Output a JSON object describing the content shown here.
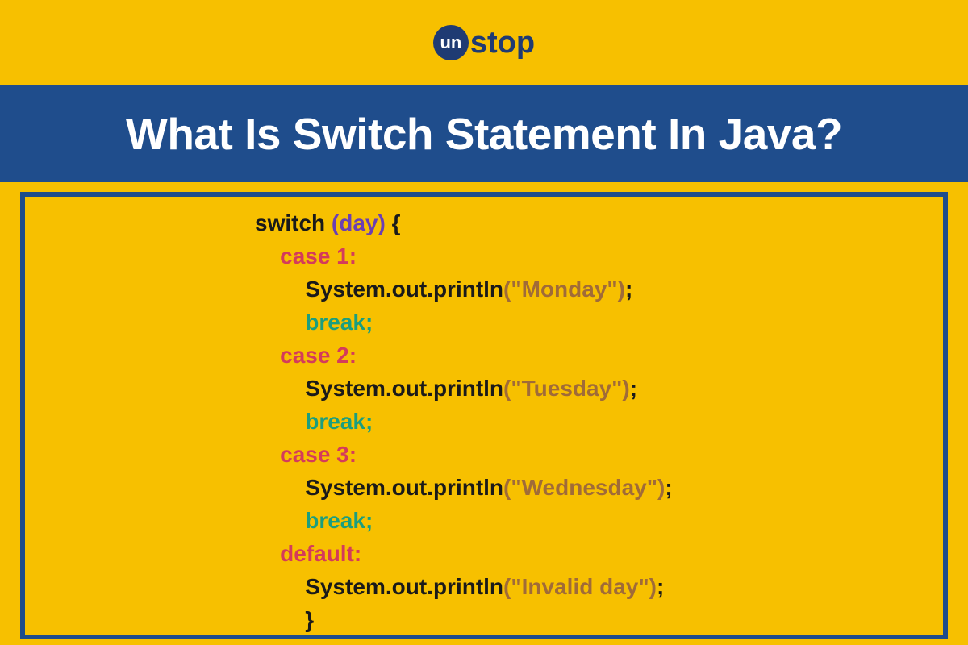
{
  "logo": {
    "circleText": "un",
    "suffix": "stop"
  },
  "title": "What Is Switch Statement In Java?",
  "code": {
    "lines": [
      [
        {
          "cls": "c-black",
          "text": "switch "
        },
        {
          "cls": "c-purple",
          "text": "(day)"
        },
        {
          "cls": "c-black",
          "text": " {"
        }
      ],
      [
        {
          "cls": "c-red",
          "text": "    case 1:"
        }
      ],
      [
        {
          "cls": "c-black",
          "text": "        System.out.println"
        },
        {
          "cls": "c-string",
          "text": "(\"Monday\")"
        },
        {
          "cls": "c-black",
          "text": ";"
        }
      ],
      [
        {
          "cls": "c-teal",
          "text": "        break;"
        }
      ],
      [
        {
          "cls": "c-red",
          "text": "    case 2:"
        }
      ],
      [
        {
          "cls": "c-black",
          "text": "        System.out.println"
        },
        {
          "cls": "c-string",
          "text": "(\"Tuesday\")"
        },
        {
          "cls": "c-black",
          "text": ";"
        }
      ],
      [
        {
          "cls": "c-teal",
          "text": "        break;"
        }
      ],
      [
        {
          "cls": "c-red",
          "text": "    case 3:"
        }
      ],
      [
        {
          "cls": "c-black",
          "text": "        System.out.println"
        },
        {
          "cls": "c-string",
          "text": "(\"Wednesday\")"
        },
        {
          "cls": "c-black",
          "text": ";"
        }
      ],
      [
        {
          "cls": "c-teal",
          "text": "        break;"
        }
      ],
      [
        {
          "cls": "c-red",
          "text": "    default:"
        }
      ],
      [
        {
          "cls": "c-black",
          "text": "        System.out.println"
        },
        {
          "cls": "c-string",
          "text": "(\"Invalid day\")"
        },
        {
          "cls": "c-black",
          "text": ";"
        }
      ],
      [
        {
          "cls": "c-black",
          "text": "        }"
        }
      ]
    ]
  }
}
